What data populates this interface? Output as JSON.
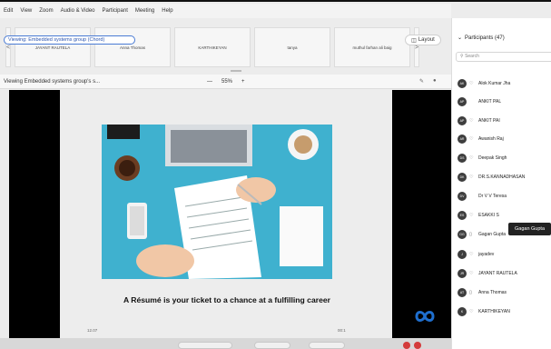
{
  "menu": [
    "Edit",
    "View",
    "Zoom",
    "Audio & Video",
    "Participant",
    "Meeting",
    "Help"
  ],
  "sharing": {
    "notice": "Viewing: Embedded systems group (Chord)"
  },
  "strip": {
    "prev": "<",
    "next": ">",
    "tiles": [
      "JAYANT RAUTELA",
      "Anna Thomas",
      "KARTHIKEYAN",
      "tanya",
      "muthul farhan ali baig"
    ]
  },
  "layout": {
    "label": "Layout"
  },
  "viewbar": {
    "title": "Viewing Embedded systems group's s...",
    "zoom_minus": "—",
    "zoom_value": "55%",
    "zoom_plus": "+"
  },
  "slide": {
    "caption": "A Résumé is your ticket to a chance at a fulfilling career",
    "page_left": "12.07",
    "page_right": "00:1"
  },
  "participants": {
    "header": "Participants (47)",
    "search_placeholder": "Search",
    "items": [
      {
        "initials": "AK",
        "name": "Alok Kumar Jha",
        "mic": "off"
      },
      {
        "initials": "AP",
        "name": "ANKIT PAL",
        "mic": "none"
      },
      {
        "initials": "AP",
        "name": "ANKIT PAI",
        "mic": "off"
      },
      {
        "initials": "AR",
        "name": "Awanish Raj",
        "mic": "off"
      },
      {
        "initials": "DS",
        "name": "Deepak Singh",
        "mic": "off"
      },
      {
        "initials": "DK",
        "name": "DR.S.KANNADHASAN",
        "mic": "off"
      },
      {
        "initials": "DV",
        "name": "Dr V V Teresa",
        "mic": "none"
      },
      {
        "initials": "ES",
        "name": "ESAKKI S",
        "mic": "off"
      },
      {
        "initials": "GG",
        "name": "Gagan Gupta",
        "mic": "on"
      },
      {
        "initials": "J",
        "name": "jayadev",
        "mic": "off"
      },
      {
        "initials": "JR",
        "name": "JAYANT RAUTELA",
        "mic": "off"
      },
      {
        "initials": "AT",
        "name": "Anna Thomas",
        "mic": "on"
      },
      {
        "initials": "K",
        "name": "KARTHIKEYAN",
        "mic": "off"
      }
    ]
  },
  "tooltip": {
    "text": "Gagan Gupta"
  },
  "colors": {
    "accent": "#4a7bd4",
    "panel_bg": "#ffffff",
    "slide_bg": "#3fb1cf"
  }
}
